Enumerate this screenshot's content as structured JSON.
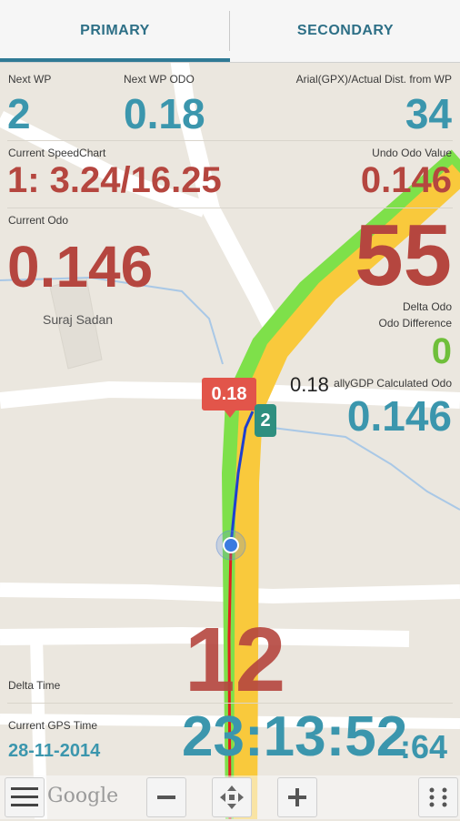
{
  "tabs": {
    "primary": "PRIMARY",
    "secondary": "SECONDARY"
  },
  "next_wp": {
    "label": "Next WP",
    "value": "2"
  },
  "next_wp_odo": {
    "label": "Next WP ODO",
    "value": "0.18"
  },
  "arial_dist": {
    "label": "Arial(GPX)/Actual Dist. from WP",
    "value": "34"
  },
  "current_speed_chart": {
    "label": "Current SpeedChart",
    "value": "1: 3.24/16.25"
  },
  "undo_odo": {
    "label": "Undo Odo Value",
    "value": "0.146"
  },
  "current_odo": {
    "label": "Current Odo",
    "value": "0.146"
  },
  "speed_big": "55",
  "delta_odo": {
    "label": "Delta Odo"
  },
  "odo_difference": {
    "label": "Odo Difference",
    "value": "0"
  },
  "map_odo_readout": "0.18",
  "rally_gdp": {
    "label": "allyGDP Calculated Odo",
    "value": "0.146"
  },
  "map_place": "Suraj Sadan",
  "marker": {
    "odo": "0.18",
    "wp": "2"
  },
  "delta_time": {
    "label": "Delta Time",
    "value": "12"
  },
  "gps_time": {
    "label": "Current GPS Time",
    "date": "28-11-2014",
    "time": "23:13:52",
    "seconds": ":64"
  },
  "map_brand": "Google",
  "icons": [
    "menu-icon",
    "zoom-out-icon",
    "move-icon",
    "zoom-in-icon",
    "overflow-icon",
    "my-location-icon"
  ],
  "colors": {
    "blue": "#3b96ad",
    "red": "#b5463f",
    "green": "#6fbf3a",
    "accent": "#2f7a95"
  }
}
